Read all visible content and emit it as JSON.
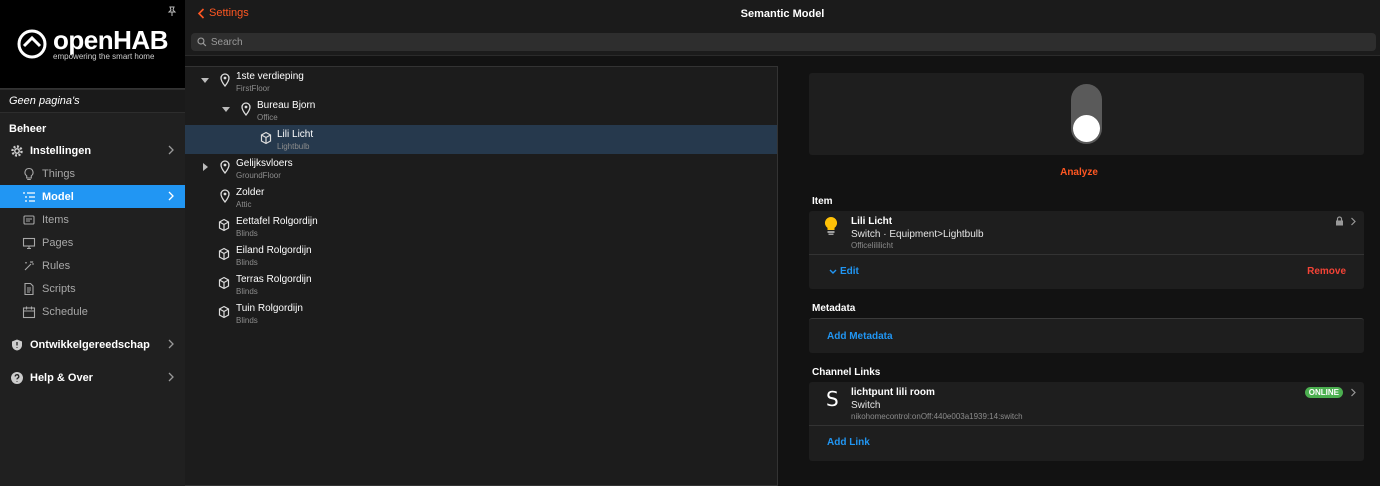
{
  "sidebar": {
    "logo": {
      "name": "openHAB",
      "tagline": "empowering the smart home"
    },
    "page_label": "Geen pagina's",
    "section_label": "Beheer",
    "settings_label": "Instellingen",
    "sub_items": [
      "Things",
      "Model",
      "Items",
      "Pages",
      "Rules",
      "Scripts",
      "Schedule"
    ],
    "active_sub": "Model",
    "dev_tools_label": "Ontwikkelgereedschap",
    "help_label": "Help & Over"
  },
  "header": {
    "back_label": "Settings",
    "title": "Semantic Model"
  },
  "search": {
    "placeholder": "Search"
  },
  "tree": {
    "nodes": [
      {
        "label": "1ste verdieping",
        "sub": "FirstFloor",
        "type": "location",
        "level": 0,
        "arrow": "down"
      },
      {
        "label": "Bureau Bjorn",
        "sub": "Office",
        "type": "location",
        "level": 1,
        "arrow": "down"
      },
      {
        "label": "Lili Licht",
        "sub": "Lightbulb",
        "type": "equipment",
        "level": 2,
        "arrow": "",
        "selected": true
      },
      {
        "label": "Gelijksvloers",
        "sub": "GroundFloor",
        "type": "location",
        "level": 0,
        "arrow": "right"
      },
      {
        "label": "Zolder",
        "sub": "Attic",
        "type": "location",
        "level": 0,
        "arrow": ""
      },
      {
        "label": "Eettafel Rolgordijn",
        "sub": "Blinds",
        "type": "equipment",
        "level": 0,
        "arrow": ""
      },
      {
        "label": "Eiland Rolgordijn",
        "sub": "Blinds",
        "type": "equipment",
        "level": 0,
        "arrow": ""
      },
      {
        "label": "Terras Rolgordijn",
        "sub": "Blinds",
        "type": "equipment",
        "level": 0,
        "arrow": ""
      },
      {
        "label": "Tuin Rolgordijn",
        "sub": "Blinds",
        "type": "equipment",
        "level": 0,
        "arrow": ""
      }
    ]
  },
  "detail": {
    "analyze_label": "Analyze",
    "toggle_on": false,
    "item_section": "Item",
    "item": {
      "title": "Lili Licht",
      "subtitle": "Switch · Equipment>Lightbulb",
      "footer": "Officelililicht"
    },
    "edit_label": "Edit",
    "remove_label": "Remove",
    "metadata_section": "Metadata",
    "add_metadata_label": "Add Metadata",
    "channel_section": "Channel Links",
    "channel": {
      "icon_letter": "S",
      "title": "lichtpunt lili room",
      "subtitle": "Switch",
      "footer": "nikohomecontrol:onOff:440e003a1939:14:switch",
      "status": "ONLINE"
    },
    "add_link_label": "Add Link"
  },
  "colors": {
    "accent_orange": "#ff5722",
    "active_blue": "#2196f3",
    "online_green": "#4caf50",
    "remove_red": "#f44336"
  }
}
